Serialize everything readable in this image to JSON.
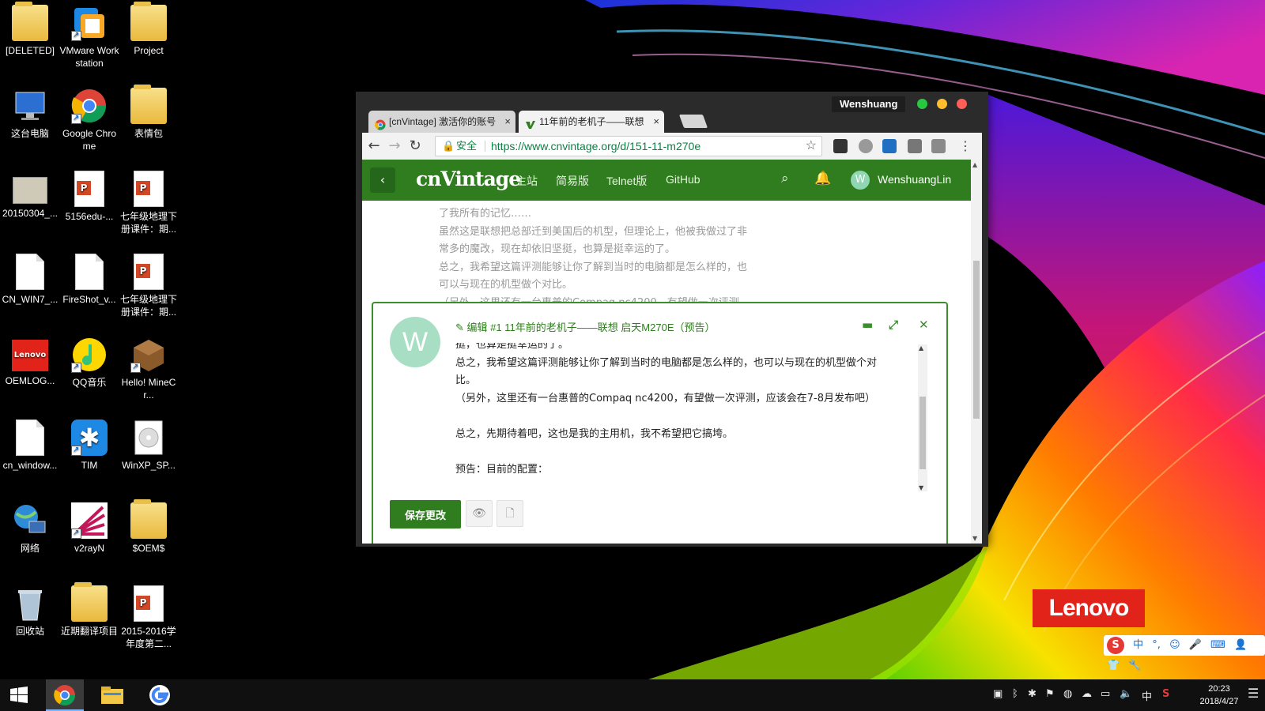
{
  "desktop": {
    "icons": [
      {
        "label": "[DELETED]",
        "icon": "folder-icon"
      },
      {
        "label": "VMware Workstation",
        "icon": "vmware-icon"
      },
      {
        "label": "Project",
        "icon": "folder-icon"
      },
      {
        "label": "这台电脑",
        "icon": "computer-icon"
      },
      {
        "label": "Google Chrome",
        "icon": "chrome-icon"
      },
      {
        "label": "表情包",
        "icon": "folder-icon"
      },
      {
        "label": "20150304_...",
        "icon": "image-thumb-icon"
      },
      {
        "label": "5156edu-...",
        "icon": "ppt-icon"
      },
      {
        "label": "七年级地理下册课件：期...",
        "icon": "ppt-icon"
      },
      {
        "label": "CN_WIN7_...",
        "icon": "file-icon"
      },
      {
        "label": "FireShot_v...",
        "icon": "file-icon"
      },
      {
        "label": "七年级地理下册课件：期...",
        "icon": "ppt-icon"
      },
      {
        "label": "OEMLOG...",
        "icon": "lenovo-image-icon"
      },
      {
        "label": "QQ音乐",
        "icon": "qqmusic-icon"
      },
      {
        "label": "Hello! MineCr...",
        "icon": "minecraft-icon"
      },
      {
        "label": "cn_window...",
        "icon": "file-icon"
      },
      {
        "label": "TIM",
        "icon": "tim-icon"
      },
      {
        "label": "WinXP_SP...",
        "icon": "disc-icon"
      },
      {
        "label": "网络",
        "icon": "network-icon"
      },
      {
        "label": "v2rayN",
        "icon": "v2ray-icon"
      },
      {
        "label": "$OEM$",
        "icon": "folder-icon"
      },
      {
        "label": "回收站",
        "icon": "recycle-bin-icon"
      },
      {
        "label": "近期翻译项目",
        "icon": "folder-icon"
      },
      {
        "label": "2015-2016学年度第二...",
        "icon": "ppt-icon"
      }
    ]
  },
  "browser": {
    "profile_name": "Wenshuang",
    "tabs": [
      {
        "title": "[cnVintage] 激活你的账号",
        "active": false
      },
      {
        "title": "11年前的老机子——联想",
        "active": true
      }
    ],
    "close_glyph": "×",
    "security_label": "安全",
    "url": "https://www.cnvintage.org/d/151-11-m270e"
  },
  "site": {
    "logo": "cnVintage",
    "nav": [
      "主站",
      "简易版",
      "Telnet版",
      "GitHub"
    ],
    "user_initial": "W",
    "user_name": "WenshuangLin"
  },
  "article": {
    "lines": [
      "了我所有的记忆……",
      "虽然这是联想把总部迁到美国后的机型，但理论上，他被我做过了非",
      "常多的魔改，现在却依旧坚挺，也算是挺幸运的了。",
      "总之，我希望这篇评测能够让你了解到当时的电脑都是怎么样的，也",
      "可以与现在的机型做个对比。",
      "（另外，这里还有一台惠普的Compaq nc4200，有望做一次评测"
    ]
  },
  "composer": {
    "avatar_initial": "W",
    "title": "编辑 #1 11年前的老机子——联想 启天M270E（预告）",
    "lines": [
      "挺，也算是挺幸运的了。",
      "总之，我希望这篇评测能够让你了解到当时的电脑都是怎么样的，也可以与现在的机型做个对",
      "比。",
      "（另外，这里还有一台惠普的Compaq nc4200，有望做一次评测，应该会在7-8月发布吧）",
      "",
      "总之，先期待着吧，这也是我的主用机，我不希望把它搞垮。",
      "",
      "预告：目前的配置："
    ],
    "save_label": "保存更改"
  },
  "wallpaper": {
    "brand": "Lenovo"
  },
  "ime": {
    "items": [
      "中",
      "°,",
      "☺",
      "🎤",
      "⌨",
      "👤",
      "👕",
      "🔧"
    ]
  },
  "taskbar": {
    "tray_lang": "中",
    "time": "20:23",
    "date": "2018/4/27"
  },
  "colors": {
    "site_green": "#2f7d1e",
    "chrome_dark": "#2b2b2b",
    "lenovo_red": "#e2231a"
  }
}
